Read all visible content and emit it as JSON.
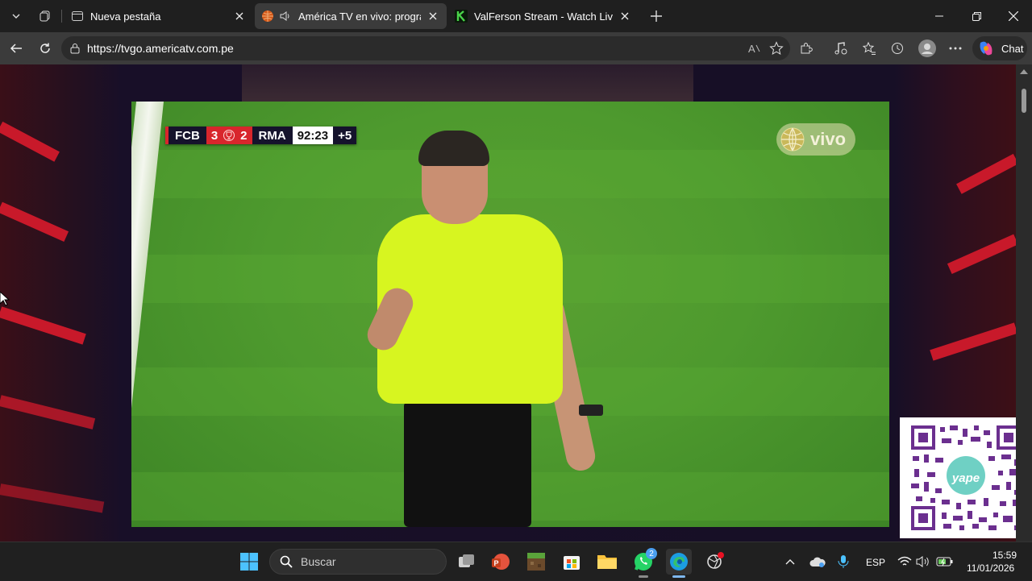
{
  "browser": {
    "tabs": [
      {
        "title": "Nueva pestaña",
        "icon": "new-tab-page-icon",
        "active": false
      },
      {
        "title": "América TV en vivo: programa",
        "icon": "globe-icon",
        "active": true,
        "audio": true
      },
      {
        "title": "ValFerson Stream - Watch Live on",
        "icon": "k-logo-icon",
        "active": false
      }
    ],
    "address": "https://tvgo.americatv.com.pe",
    "chat_label": "Chat"
  },
  "broadcast": {
    "home_team": "FCB",
    "home_score": "3",
    "away_score": "2",
    "away_team": "RMA",
    "clock": "92:23",
    "added_time": "+5",
    "live_badge": "vivo",
    "qr_brand": "yape"
  },
  "colors": {
    "score_red": "#d8262c",
    "scorebug_navy": "#15132c",
    "referee_shirt": "#d7f520",
    "pitch_green": "#4e9a2e",
    "accent_red": "#c8192a"
  },
  "taskbar": {
    "search_placeholder": "Buscar",
    "whatsapp_badge": "2",
    "language": "ESP",
    "time": "15:59",
    "date": "11/01/2026"
  }
}
